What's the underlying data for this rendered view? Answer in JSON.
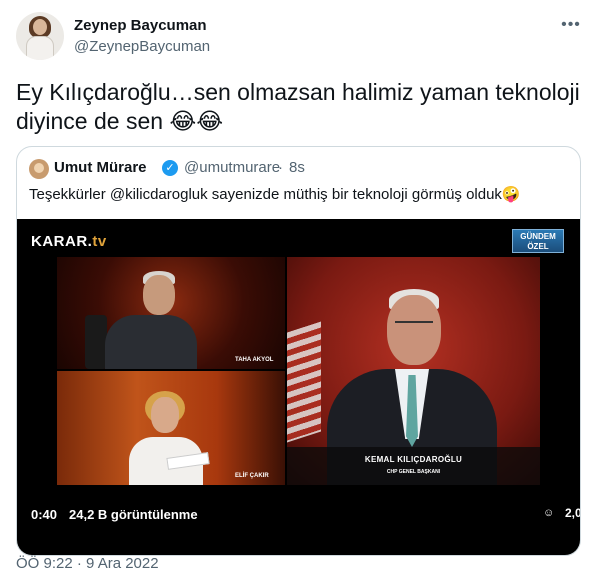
{
  "author": {
    "name": "Zeynep Baycuman",
    "handle": "@ZeynepBaycuman",
    "avatar_icon": "profile-photo"
  },
  "menu_icon": "more-options-icon",
  "tweet": {
    "text": "Ey Kılıçdaroğlu…sen olmazsan halimiz yaman teknoloji diyince de sen 😂😂"
  },
  "quote": {
    "name": "Umut Mürare",
    "verified_icon": "verified-badge-icon",
    "handle": "@umutmurare",
    "separator": "·",
    "time": "8s",
    "text": "Teşekkürler @kilicdarogluk sayenizde müthiş bir teknoloji görmüş olduk🤪",
    "video": {
      "logo_main": "KARAR.",
      "logo_tv": "tv",
      "badge_line1": "GÜNDEM",
      "badge_line2": "ÖZEL",
      "panel1_label": "TAHA AKYOL",
      "panel2_label": "ELİF ÇAKIR",
      "main_name": "KEMAL KILIÇDAROĞLU",
      "main_title": "CHP GENEL BAŞKANI",
      "elapsed": "0:40",
      "views": "24,2 B görüntülenme",
      "tag_icon": "person-tag-icon",
      "tag_text": "2,0"
    }
  },
  "timestamp": "ÖÖ 9:22 · 9 Ara 2022",
  "colors": {
    "text_primary": "#0f1419",
    "text_secondary": "#536471",
    "border": "#cfd9de",
    "verified": "#1d9bf0"
  }
}
